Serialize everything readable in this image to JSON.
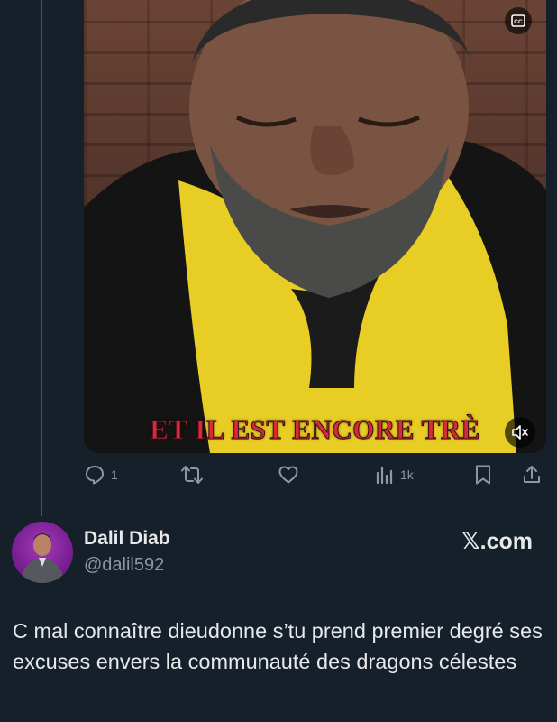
{
  "video": {
    "caption": "ET IL EST ENCORE TRÈ",
    "cc_icon": "closed-captions-icon",
    "mute_icon": "speaker-muted-icon"
  },
  "actions": {
    "reply_count": "1",
    "retweet_count": "",
    "like_count": "",
    "views_count": "1k",
    "icons": [
      "reply-icon",
      "retweet-icon",
      "like-icon",
      "views-icon",
      "bookmark-icon",
      "share-icon"
    ]
  },
  "author": {
    "name": "Dalil Diab",
    "handle": "@dalil592"
  },
  "brand": {
    "x_glyph": "𝕏",
    "label": ".com"
  },
  "tweet": {
    "text": "C mal connaître dieudonne s’tu prend premier degré ses excuses envers la communauté des dragons célestes"
  },
  "colors": {
    "background": "#15202b",
    "text": "#e7e9ea",
    "muted": "#8b98a5",
    "caption": "#d9293d"
  }
}
